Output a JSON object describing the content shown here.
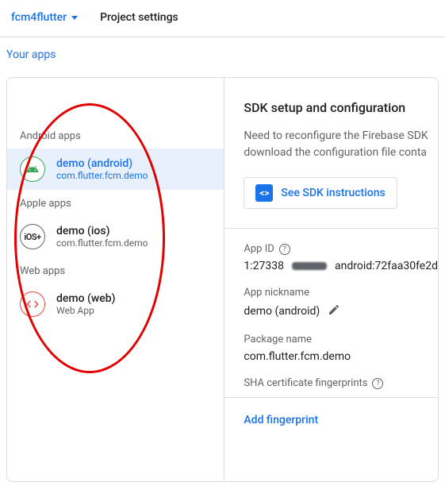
{
  "header": {
    "project_name": "fcm4flutter",
    "page_title": "Project settings"
  },
  "section_label": "Your apps",
  "apps": {
    "groups": {
      "android": {
        "label": "Android apps",
        "item": {
          "name": "demo (android)",
          "sub": "com.flutter.fcm.demo"
        }
      },
      "apple": {
        "label": "Apple apps",
        "item": {
          "name": "demo (ios)",
          "sub": "com.flutter.fcm.demo"
        }
      },
      "web": {
        "label": "Web apps",
        "item": {
          "name": "demo (web)",
          "sub": "Web App"
        }
      }
    }
  },
  "detail": {
    "title": "SDK setup and configuration",
    "desc_line1": "Need to reconfigure the Firebase SDK",
    "desc_line2": "download the configuration file conta",
    "sdk_button": "See SDK instructions",
    "app_id": {
      "label": "App ID",
      "value_prefix": "1:27338",
      "value_suffix": "android:72faa30fe2d"
    },
    "nickname": {
      "label": "App nickname",
      "value": "demo (android)"
    },
    "package": {
      "label": "Package name",
      "value": "com.flutter.fcm.demo"
    },
    "sha": {
      "label": "SHA certificate fingerprints",
      "add_link": "Add fingerprint"
    }
  }
}
